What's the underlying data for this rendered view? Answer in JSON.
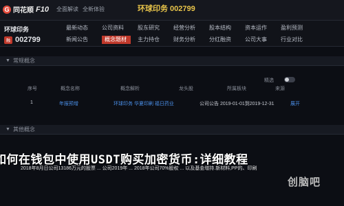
{
  "app": {
    "logo_mark": "G",
    "brand": "同花顺",
    "brand_suffix": "F10",
    "headline": "环球印务 002799"
  },
  "top_nav": [
    "全面解读",
    "全新体验"
  ],
  "stock": {
    "name": "环球印务",
    "tag": "融",
    "code": "002799"
  },
  "menu": [
    [
      "最新动态",
      "公司资料",
      "股东研究",
      "经营分析",
      "股本结构",
      "资本运作",
      "盈利预测"
    ],
    [
      "新闻公告",
      "概念题材",
      "主力持仓",
      "财务分析",
      "分红融资",
      "公司大事",
      "行业对比"
    ]
  ],
  "menu_active": "概念题材",
  "panel1": {
    "title": "常规概念"
  },
  "table": {
    "headers": [
      "序号",
      "概念名称",
      "概念解析",
      "龙头股",
      "所属板块",
      "来源"
    ],
    "toggle_label": "精选",
    "rows": [
      {
        "index": "1",
        "name": "年报预增",
        "tags": "环球印务 华夏印刷 福日药业",
        "source": "公司公告 2019-01-01到2019-12-31",
        "action": "展开"
      }
    ]
  },
  "panel2": {
    "title": "其他概念"
  },
  "overlay": {
    "title": "如何在钱包中使用USDT购买加密货币:详细教程",
    "body": "2018年8月日公司13186万元的股票 ... 公司2019年 ... 2018年公司70%股权 ... 以及基金增持.新材料,PP的、印刷",
    "stamp": "创脑吧"
  }
}
